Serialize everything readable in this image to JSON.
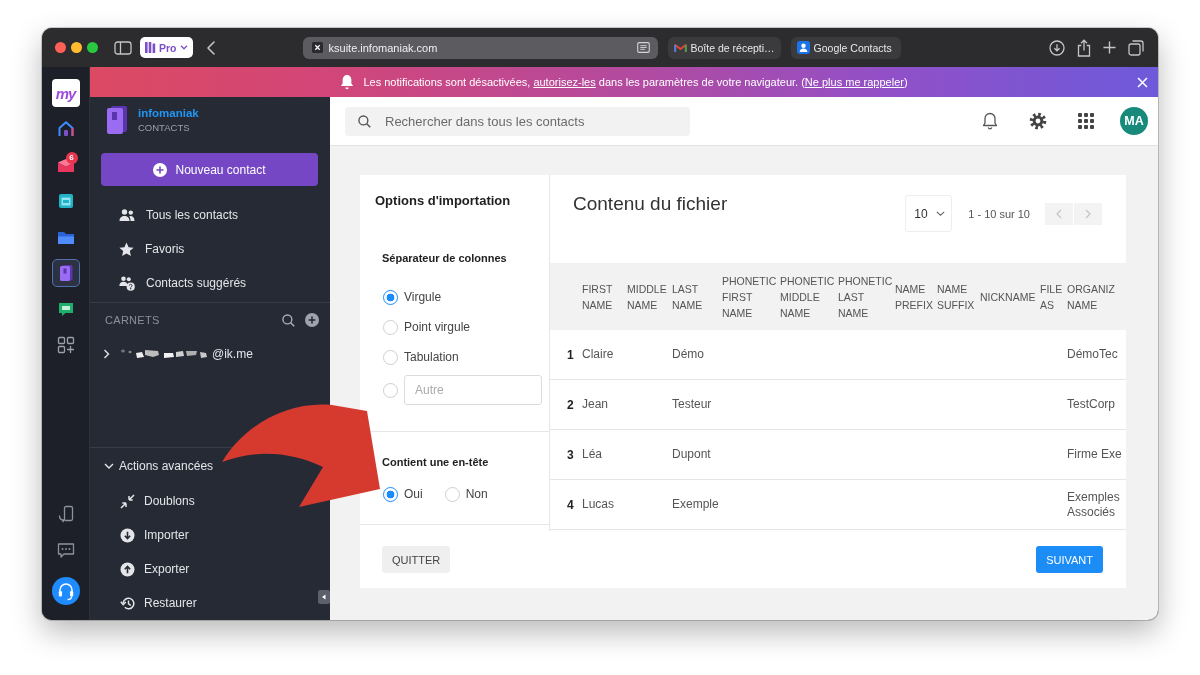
{
  "browser": {
    "profile": "Pro",
    "url": "ksuite.infomaniak.com",
    "tabs": [
      {
        "title": "Boîte de récepti…",
        "selected": false
      },
      {
        "title": "Google Contacts",
        "selected": false
      }
    ]
  },
  "rail": {
    "logo": "my",
    "apps": [
      {
        "selected": false
      },
      {
        "selected": false,
        "badge": "6"
      },
      {
        "selected": false
      },
      {
        "selected": false
      },
      {
        "selected": true
      },
      {
        "selected": false
      },
      {
        "selected": false
      }
    ]
  },
  "notification": {
    "segments": [
      {
        "kind": "text",
        "text": "Les notifications sont désactivées, "
      },
      {
        "kind": "link",
        "text": "autorisez-les"
      },
      {
        "kind": "text",
        "text": " dans les paramètres de votre navigateur. ("
      },
      {
        "kind": "link",
        "text": "Ne plus me rappeler"
      },
      {
        "kind": "text",
        "text": ")"
      }
    ]
  },
  "sidebar": {
    "brand": "infomaniak",
    "product": "CONTACTS",
    "new_contact": "Nouveau contact",
    "nav": [
      {
        "label": "Tous les contacts",
        "selected": false
      },
      {
        "label": "Favoris",
        "selected": false
      },
      {
        "label": "Contacts suggérés",
        "selected": false
      }
    ],
    "address_books_title": "CARNETS",
    "address_books": [
      {
        "label": "@ik.me",
        "expanded": false
      }
    ],
    "advanced": {
      "title": "Actions avancées",
      "expanded": true,
      "items": [
        {
          "label": "Doublons",
          "selected": false
        },
        {
          "label": "Importer",
          "selected": false
        },
        {
          "label": "Exporter",
          "selected": false
        },
        {
          "label": "Restaurer",
          "selected": false
        }
      ]
    }
  },
  "header": {
    "search_placeholder": "Rechercher dans tous les contacts",
    "avatar": "MA"
  },
  "import": {
    "options_title": "Options d'importation",
    "separator_title": "Séparateur de colonnes",
    "separators": [
      {
        "kind": "option",
        "label": "Virgule",
        "selected": true
      },
      {
        "kind": "option",
        "label": "Point virgule",
        "selected": false
      },
      {
        "kind": "option",
        "label": "Tabulation",
        "selected": false
      },
      {
        "kind": "custom",
        "placeholder": "Autre",
        "selected": false
      }
    ],
    "header_title": "Contient une en-tête",
    "header_options": [
      {
        "label": "Oui",
        "selected": true
      },
      {
        "label": "Non",
        "selected": false
      }
    ],
    "file_title": "Contenu du fichier",
    "page_size": "10",
    "range": "1 - 10 sur 10",
    "pager": [
      {
        "disabled": true
      },
      {
        "disabled": true
      }
    ],
    "table": {
      "columns": [
        "FIRST NAME",
        "MIDDLE NAME",
        "LAST NAME",
        "PHONETIC FIRST NAME",
        "PHONETIC MIDDLE NAME",
        "PHONETIC LAST NAME",
        "NAME PREFIX",
        "NAME SUFFIX",
        "NICKNAME",
        "FILE AS",
        "ORGANIZ NAME"
      ],
      "rows": [
        {
          "number": "1",
          "cells": [
            "Claire",
            null,
            "Démo",
            null,
            null,
            null,
            null,
            null,
            null,
            null,
            "DémoTec"
          ]
        },
        {
          "number": "2",
          "cells": [
            "Jean",
            null,
            "Testeur",
            null,
            null,
            null,
            null,
            null,
            null,
            null,
            "TestCorp"
          ]
        },
        {
          "number": "3",
          "cells": [
            "Léa",
            null,
            "Dupont",
            null,
            null,
            null,
            null,
            null,
            null,
            null,
            "Firme Exe"
          ]
        },
        {
          "number": "4",
          "cells": [
            "Lucas",
            null,
            "Exemple",
            null,
            null,
            null,
            null,
            null,
            null,
            null,
            "Exemples Associés"
          ]
        }
      ]
    },
    "buttons": [
      {
        "label": "QUITTER",
        "kind": "secondary"
      },
      {
        "label": "SUIVANT",
        "kind": "primary"
      }
    ]
  }
}
